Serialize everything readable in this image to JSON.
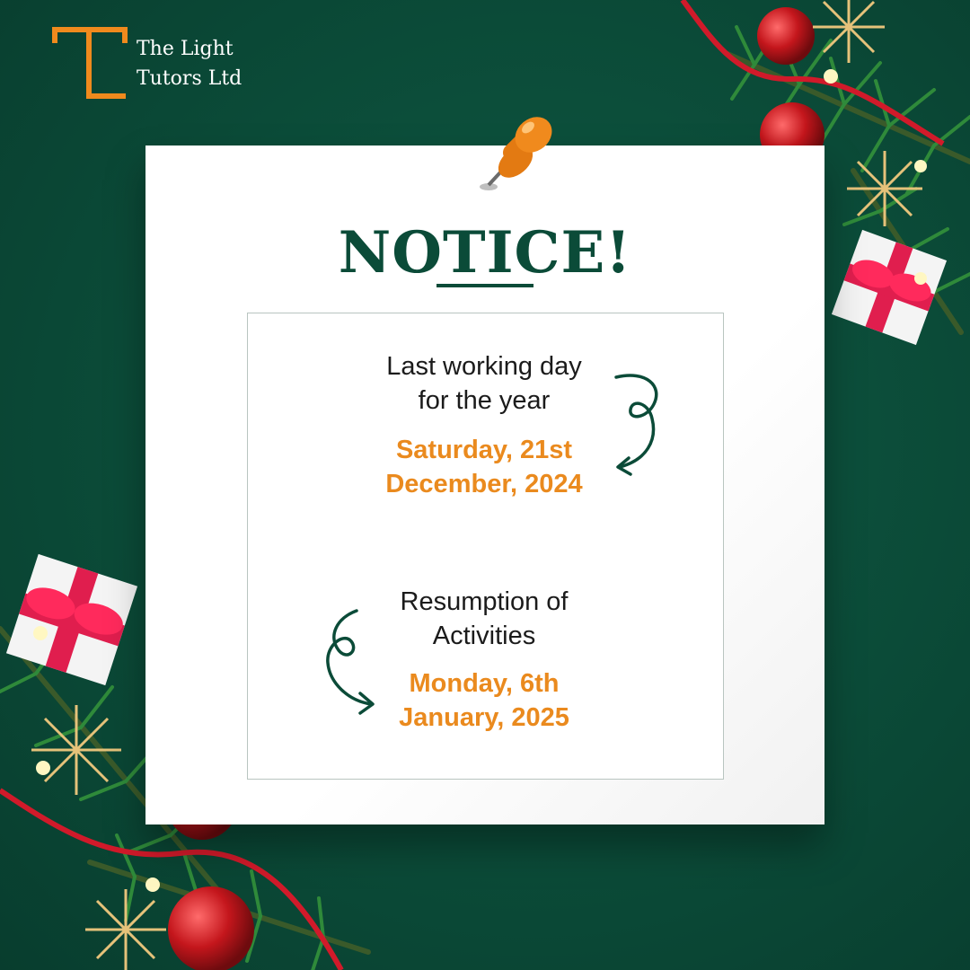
{
  "brand": {
    "line1": "The Light",
    "line2": "Tutors Ltd",
    "mark_icon": "orange-t-logo-icon",
    "accent_color": "#f08a1d"
  },
  "notice": {
    "title": "NOTICE!",
    "title_color": "#0b4b38"
  },
  "blocks": [
    {
      "label_line1": "Last working day",
      "label_line2": "for the year",
      "date_line1": "Saturday, 21st",
      "date_line2": "December, 2024"
    },
    {
      "label_line1": "Resumption of",
      "label_line2": "Activities",
      "date_line1": "Monday, 6th",
      "date_line2": "January, 2025"
    }
  ],
  "colors": {
    "background": "#0b4b38",
    "date_text": "#ea8a1e",
    "pin": "#f08a1d"
  }
}
